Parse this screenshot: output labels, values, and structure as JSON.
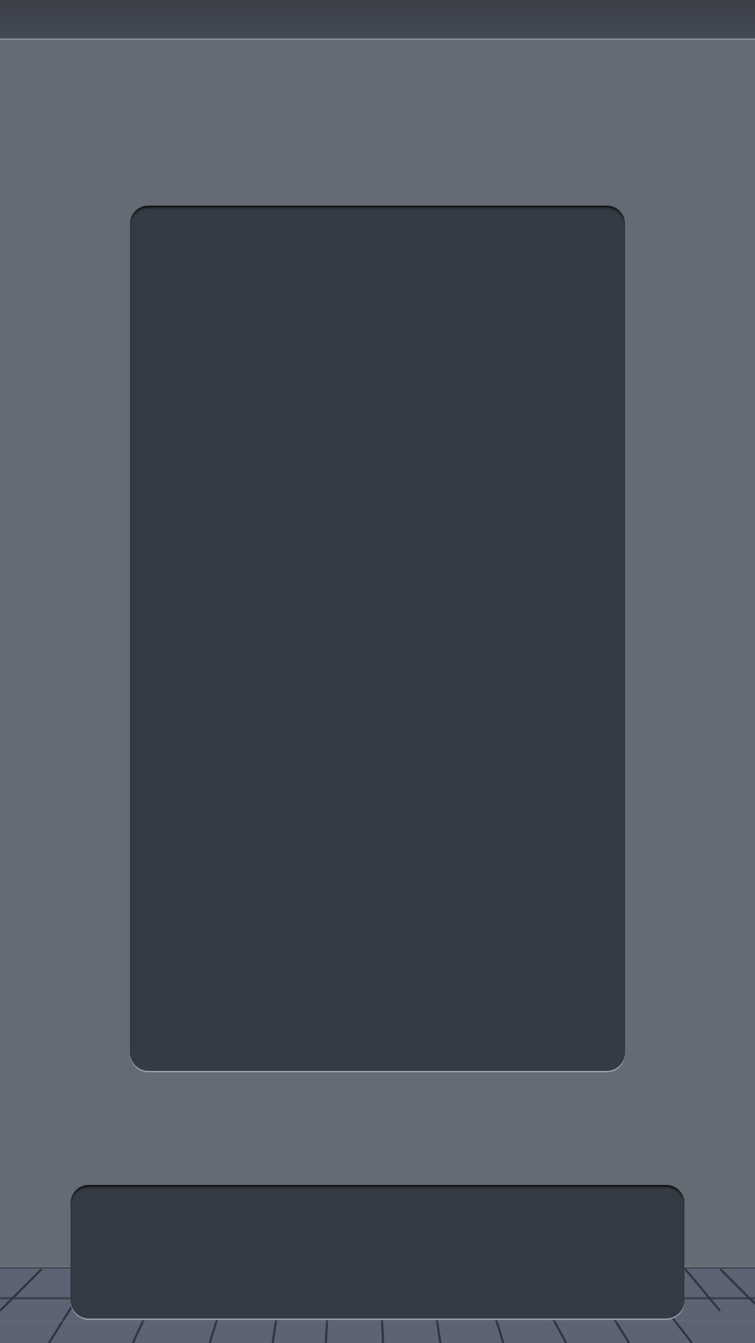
{
  "colors": {
    "wall": "#646b75",
    "panel": "#353b44",
    "status_bar": "#3f444d",
    "floor": "#5a6170"
  }
}
